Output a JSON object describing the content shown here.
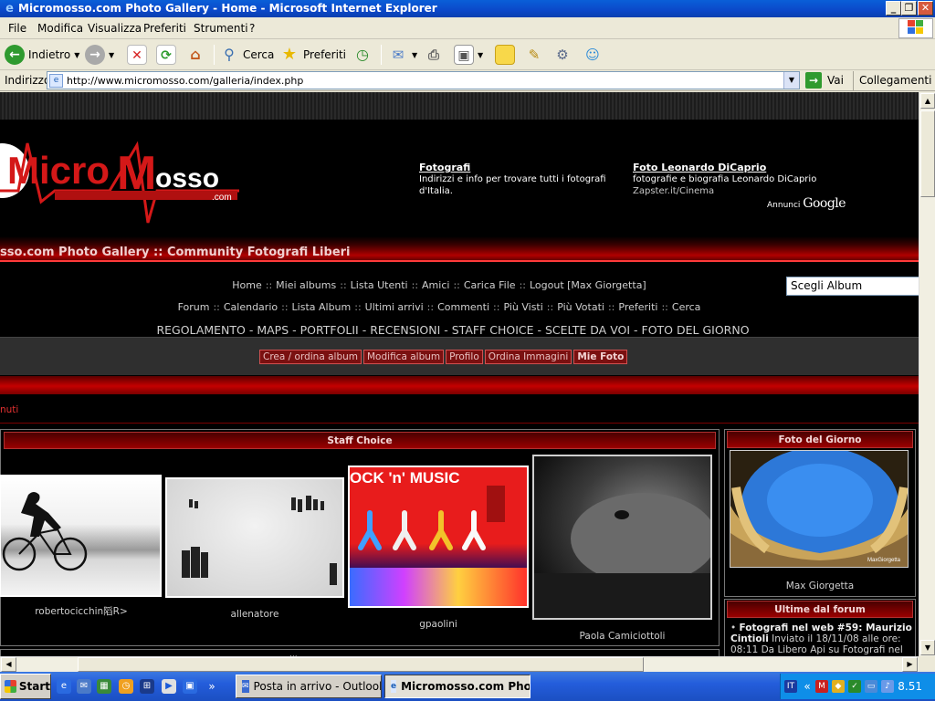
{
  "window": {
    "title": "Micromosso.com Photo Gallery - Home - Microsoft Internet Explorer",
    "minimize": "_",
    "restore": "❐",
    "close": "✕"
  },
  "menubar": [
    "File",
    "Modifica",
    "Visualizza",
    "Preferiti",
    "Strumenti",
    "?"
  ],
  "toolbar": {
    "back_label": "Indietro",
    "search_label": "Cerca",
    "favorites_label": "Preferiti"
  },
  "addressbar": {
    "label": "Indirizzo",
    "url": "http://www.micromosso.com/galleria/index.php",
    "go_label": "Vai",
    "links_label": "Collegamenti"
  },
  "page": {
    "logo": {
      "micro": "Micro",
      "m": "M",
      "osso": "osso",
      "dotcom": ".com"
    },
    "ads": [
      {
        "title": "Fotografi",
        "desc": "Indirizzi e info per trovare tutti i fotografi d'Italia.",
        "url": ""
      },
      {
        "title": "Foto Leonardo DiCaprio",
        "desc": "fotografie e biografia Leonardo DiCaprio",
        "url": "Zapster.it/Cinema"
      }
    ],
    "ads_by": "Annunci",
    "ads_brand": "Google",
    "banner_title": "sso.com Photo Gallery :: Community Fotografi Liberi",
    "nav_row1": [
      "Home",
      "Miei albums",
      "Lista Utenti",
      "Amici",
      "Carica File",
      "Logout [Max Giorgetta]"
    ],
    "nav_row2": [
      "Forum",
      "Calendario",
      "Lista Album",
      "Ultimi arrivi",
      "Commenti",
      "Più Visti",
      "Più Votati",
      "Preferiti",
      "Cerca"
    ],
    "nav_separator": "::",
    "big_nav": "REGOLAMENTO - MAPS - PORTFOLII - RECENSIONI - STAFF CHOICE - SCELTE DA VOI - FOTO DEL GIORNO",
    "album_select": "Scegli Album",
    "action_buttons": [
      "Crea / ordina album",
      "Modifica album",
      "Profilo",
      "Ordina Immagini",
      "Mie Foto"
    ],
    "crumb": "nuti",
    "staff_choice": {
      "heading": "Staff Choice",
      "items": [
        {
          "caption": "robertocicchin䧟R>"
        },
        {
          "caption": "allenatore"
        },
        {
          "caption": "gpaolini",
          "photo_text": "OCK 'n' MUSIC"
        },
        {
          "caption": "Paola Camiciottoli"
        }
      ]
    },
    "foto_del_giorno": {
      "heading": "Foto del Giorno",
      "caption": "Max Giorgetta",
      "watermark": "MaxGiorgetta"
    },
    "forum": {
      "heading": "Ultime dal forum",
      "bullet": "•",
      "post_title": "Fotografi nel web #59: Maurizio Cintioli",
      "post_text": "Inviato il 18/11/08 alle ore: 08:11 Da Libero Api su Fotografi nel"
    },
    "next_heading": "..."
  },
  "taskbar": {
    "start_label": "Start",
    "tasks": [
      {
        "label": "Posta in arrivo - Outlook ..."
      },
      {
        "label": "Micromosso.com Pho..."
      }
    ],
    "tray_lang": "IT",
    "tray_chevron": "«",
    "clock": "8.51"
  },
  "colors": {
    "accent_red": "#c40000",
    "xp_blue": "#0b48c9",
    "page_bg": "#000000"
  }
}
